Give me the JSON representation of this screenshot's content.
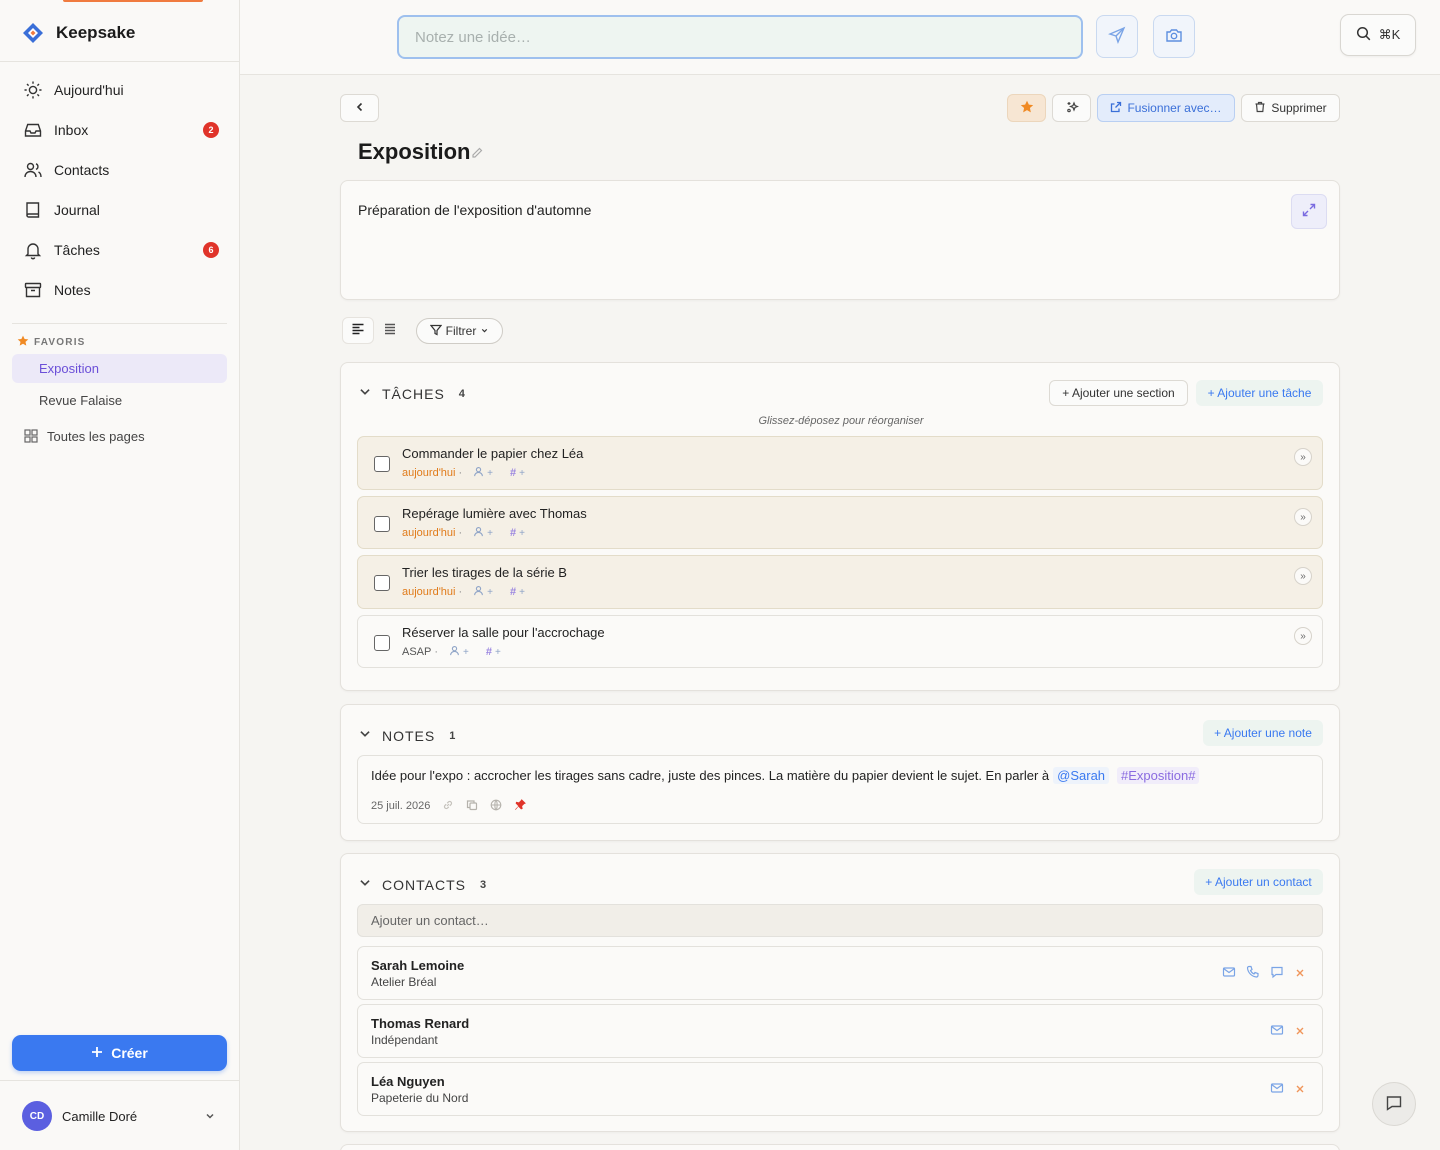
{
  "app": {
    "name": "Keepsake"
  },
  "nav": [
    {
      "label": "Aujourd'hui",
      "icon": "sun-icon"
    },
    {
      "label": "Inbox",
      "icon": "inbox-icon",
      "badge": "2"
    },
    {
      "label": "Contacts",
      "icon": "users-icon"
    },
    {
      "label": "Journal",
      "icon": "book-icon"
    },
    {
      "label": "Tâches",
      "icon": "bell-icon",
      "badge": "6"
    },
    {
      "label": "Notes",
      "icon": "archive-icon"
    }
  ],
  "favorites": {
    "heading": "FAVORIS",
    "items": [
      {
        "label": "Exposition",
        "active": true
      },
      {
        "label": "Revue Falaise",
        "active": false
      }
    ],
    "all_pages": "Toutes les pages"
  },
  "create_label": "Créer",
  "user": {
    "initials": "CD",
    "name": "Camille Doré"
  },
  "topbar": {
    "placeholder": "Notez une idée…",
    "search_shortcut": "⌘K"
  },
  "page": {
    "title": "Exposition",
    "description": "Préparation de l'exposition d'automne",
    "actions": {
      "merge": "Fusionner avec…",
      "delete": "Supprimer"
    },
    "filter_label": "Filtrer"
  },
  "tasks": {
    "title": "TÂCHES",
    "count": "4",
    "add_section": "+ Ajouter une section",
    "add_task": "+ Ajouter une tâche",
    "hint": "Glissez-déposez pour réorganiser",
    "items": [
      {
        "title": "Commander le papier chez Léa",
        "due": "aujourd'hui"
      },
      {
        "title": "Repérage lumière avec Thomas",
        "due": "aujourd'hui"
      },
      {
        "title": "Trier les tirages de la série B",
        "due": "aujourd'hui"
      },
      {
        "title": "Réserver la salle pour l'accrochage",
        "due": "ASAP"
      }
    ]
  },
  "notes": {
    "title": "NOTES",
    "count": "1",
    "add_note": "+ Ajouter une note",
    "items": [
      {
        "text": "Idée pour l'expo : accrocher les tirages sans cadre, juste des pinces. La matière du papier devient le sujet. En parler à",
        "mention": "@Sarah",
        "tag": "#Exposition#",
        "date": "25 juil. 2026"
      }
    ]
  },
  "contacts": {
    "title": "CONTACTS",
    "count": "3",
    "add_contact": "+ Ajouter un contact",
    "input_placeholder": "Ajouter un contact…",
    "items": [
      {
        "name": "Sarah Lemoine",
        "company": "Atelier Bréal"
      },
      {
        "name": "Thomas Renard",
        "company": "Indépendant"
      },
      {
        "name": "Léa Nguyen",
        "company": "Papeterie du Nord"
      }
    ]
  },
  "colors": {
    "accent": "#3a79f0",
    "brand": "#f07b3f",
    "favorite_active": "#6b4fd8",
    "due_today": "#e07b1a",
    "badge": "#e0342a"
  }
}
